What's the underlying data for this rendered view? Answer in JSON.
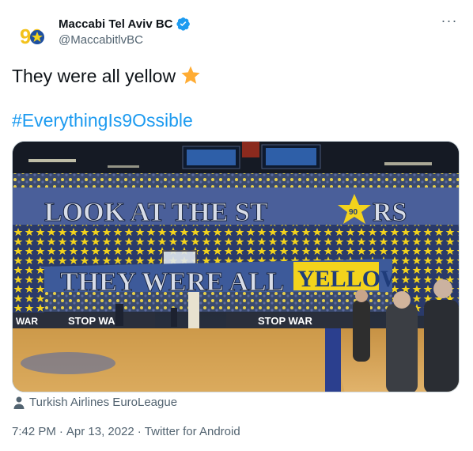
{
  "author": {
    "display_name": "Maccabi Tel Aviv BC",
    "handle": "@MaccabitlvBC",
    "verified": true,
    "avatar_icon": "maccabi-90-logo",
    "avatar_logo_text": "90"
  },
  "menu": {
    "more_label": "···"
  },
  "tweet": {
    "text": "They were all yellow",
    "emoji": "star",
    "hashtag": "#EverythingIs9Ossible"
  },
  "media": {
    "banner_top_text": "LOOK AT THE ST",
    "banner_top_star_text": "90",
    "banner_top_suffix": "RS",
    "banner_bottom_text": "THEY WERE ALL",
    "banner_bottom_highlight": "YELLOW",
    "board_left_text": "STOP WAR",
    "board_right_text": "STOP WAR",
    "board_edge_left": "WAR",
    "colors": {
      "yellow": "#f3d31c",
      "blue": "#1f3c7a",
      "floor": "#d8a456"
    }
  },
  "attribution": {
    "label": "Turkish Airlines EuroLeague",
    "icon": "person-icon"
  },
  "meta": {
    "time": "7:42 PM",
    "separator": "·",
    "date": "Apr 13, 2022",
    "source": "Twitter for Android"
  }
}
